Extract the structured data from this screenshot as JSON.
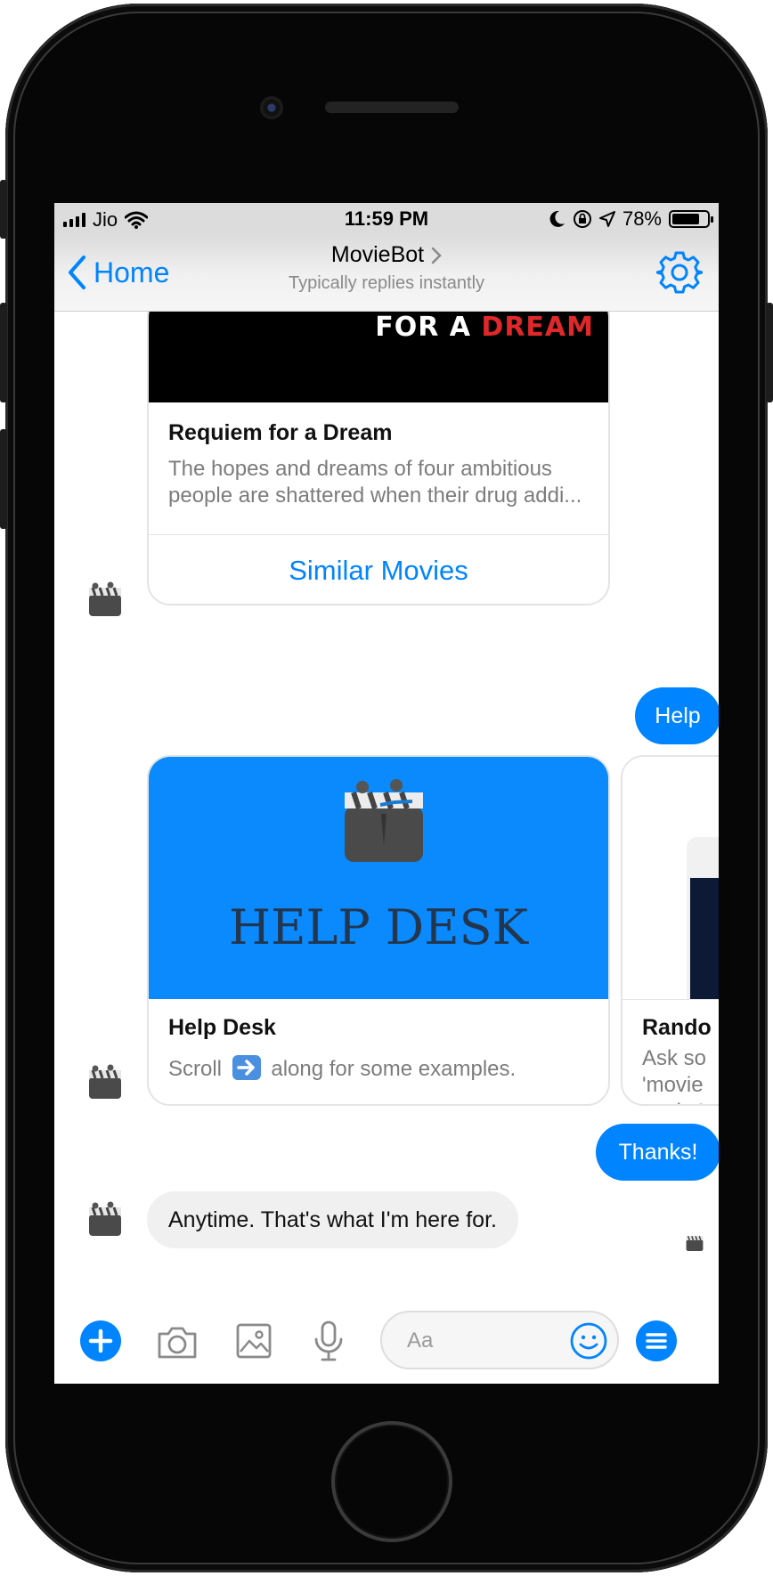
{
  "status_bar": {
    "carrier": "Jio",
    "time": "11:59 PM",
    "battery": "78%",
    "battery_level": 0.78
  },
  "nav": {
    "back_label": "Home",
    "title": "MovieBot",
    "subtitle": "Typically replies instantly"
  },
  "messages": {
    "movie_card": {
      "banner_text": "FOR A",
      "banner_text_red": "DREAM",
      "title": "Requiem for a Dream",
      "description": "The hopes and dreams of four ambitious people are shattered when their drug addi...",
      "button": "Similar Movies"
    },
    "user_help": "Help",
    "help_card": {
      "hero_text": "HELP DESK",
      "title": "Help Desk",
      "description_before": "Scroll",
      "description_after": "along for some examples."
    },
    "next_card": {
      "title_partial": "Rando",
      "description_partial": "Ask so 'movie works!"
    },
    "user_thanks": "Thanks!",
    "bot_reply": "Anytime. That's what I'm here for."
  },
  "composer": {
    "placeholder": "Aa"
  },
  "colors": {
    "accent": "#0084ff",
    "bubble_in": "#f1f0f0",
    "help_card_bg": "#0a8afc",
    "banner_red": "#e0282b"
  },
  "icons": {
    "back": "chevron-left-icon",
    "title_chevron": "chevron-right-icon",
    "settings": "gear-icon",
    "avatar": "clapperboard-icon",
    "plus": "plus-circle-icon",
    "camera": "camera-icon",
    "gallery": "image-icon",
    "mic": "microphone-icon",
    "emoji": "smiley-icon",
    "menu": "menu-icon"
  }
}
